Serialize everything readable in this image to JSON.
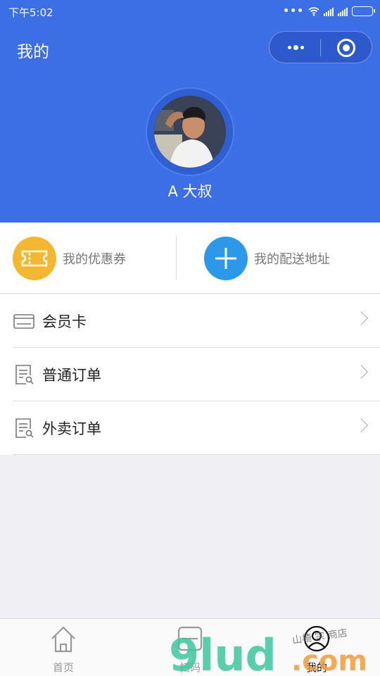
{
  "status_bar": {
    "time": "下午5:02",
    "dots": "•••"
  },
  "header": {
    "title": "我的",
    "user_name": "A 大叔"
  },
  "quick_actions": [
    {
      "label": "我的优惠券",
      "icon": "ticket-icon",
      "color": "#f5b731"
    },
    {
      "label": "我的配送地址",
      "icon": "plus-icon",
      "color": "#2d97ea"
    }
  ],
  "menu": [
    {
      "label": "会员卡",
      "icon": "card-icon"
    },
    {
      "label": "普通订单",
      "icon": "order-icon"
    },
    {
      "label": "外卖订单",
      "icon": "order-icon"
    }
  ],
  "tabbar": {
    "items": [
      {
        "label": "首页",
        "icon": "home-icon"
      },
      {
        "label": "扫码",
        "icon": "scan-icon"
      },
      {
        "label": "我的",
        "icon": "user-icon"
      }
    ]
  },
  "watermark": {
    "text": "9lud",
    "suffix": ".com",
    "script": "山楂 宗 商店"
  },
  "colors": {
    "primary": "#3c6fe5",
    "coupon": "#f5b731",
    "address": "#2d97ea",
    "background": "#f0eff4"
  }
}
